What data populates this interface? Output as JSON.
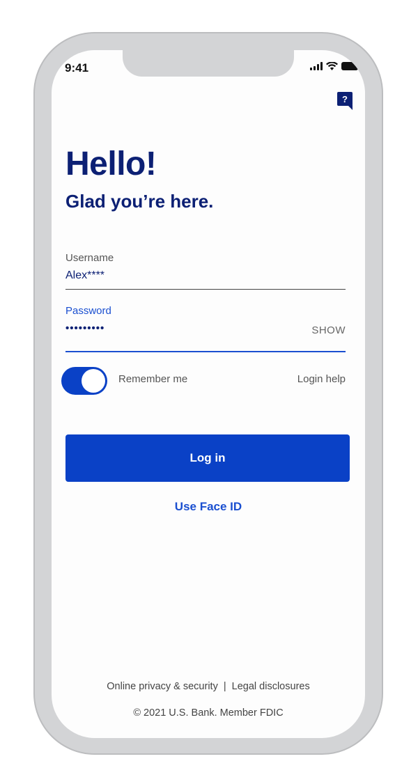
{
  "status_bar": {
    "time": "9:41"
  },
  "help": {
    "icon_label": "?"
  },
  "greeting": {
    "title": "Hello!",
    "subtitle": "Glad you’re here."
  },
  "username": {
    "label": "Username",
    "value": "Alex****"
  },
  "password": {
    "label": "Password",
    "value": "•••••••••",
    "show_label": "SHOW"
  },
  "remember_me": {
    "label": "Remember me",
    "checked": true
  },
  "login_help": "Login help",
  "login_button": "Log in",
  "face_id_link": "Use Face ID",
  "footer": {
    "privacy_link": "Online privacy & security",
    "separator": "|",
    "legal_link": "Legal disclosures",
    "copyright": "© 2021 U.S. Bank. Member FDIC"
  },
  "colors": {
    "brand_navy": "#0c2074",
    "accent_blue": "#0a41c6",
    "link_blue": "#1a4fd0"
  }
}
